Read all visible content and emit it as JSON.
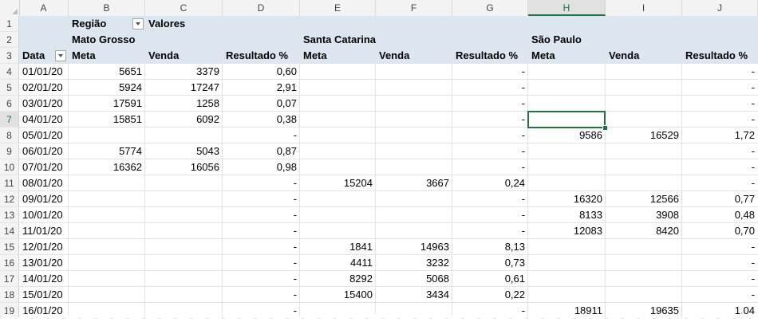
{
  "columns": [
    "A",
    "B",
    "C",
    "D",
    "E",
    "F",
    "G",
    "H",
    "I",
    "J"
  ],
  "selected_column": "H",
  "selected_row": "7",
  "pivot": {
    "row1": {
      "a": "",
      "b": "Região",
      "c": "Valores"
    },
    "regions": {
      "b": "Mato Grosso",
      "e": "Santa Catarina",
      "h": "São Paulo"
    },
    "headers": [
      "Data",
      "Meta",
      "Venda",
      "Resultado %",
      "Meta",
      "Venda",
      "Resultado %",
      "Meta",
      "Venda",
      "Resultado %"
    ]
  },
  "rows": [
    {
      "n": "4",
      "cells": [
        "01/01/20",
        "5651",
        "3379",
        "0,60",
        "",
        "",
        "-",
        "",
        "",
        "-"
      ]
    },
    {
      "n": "5",
      "cells": [
        "02/01/20",
        "5924",
        "17247",
        "2,91",
        "",
        "",
        "-",
        "",
        "",
        "-"
      ]
    },
    {
      "n": "6",
      "cells": [
        "03/01/20",
        "17591",
        "1258",
        "0,07",
        "",
        "",
        "-",
        "",
        "",
        "-"
      ]
    },
    {
      "n": "7",
      "cells": [
        "04/01/20",
        "15851",
        "6092",
        "0,38",
        "",
        "",
        "-",
        "",
        "",
        "-"
      ]
    },
    {
      "n": "8",
      "cells": [
        "05/01/20",
        "",
        "",
        "-",
        "",
        "",
        "-",
        "9586",
        "16529",
        "1,72"
      ]
    },
    {
      "n": "9",
      "cells": [
        "06/01/20",
        "5774",
        "5043",
        "0,87",
        "",
        "",
        "-",
        "",
        "",
        "-"
      ]
    },
    {
      "n": "10",
      "cells": [
        "07/01/20",
        "16362",
        "16056",
        "0,98",
        "",
        "",
        "-",
        "",
        "",
        "-"
      ]
    },
    {
      "n": "11",
      "cells": [
        "08/01/20",
        "",
        "",
        "-",
        "15204",
        "3667",
        "0,24",
        "",
        "",
        "-"
      ]
    },
    {
      "n": "12",
      "cells": [
        "09/01/20",
        "",
        "",
        "-",
        "",
        "",
        "-",
        "16320",
        "12566",
        "0,77"
      ]
    },
    {
      "n": "13",
      "cells": [
        "10/01/20",
        "",
        "",
        "-",
        "",
        "",
        "-",
        "8133",
        "3908",
        "0,48"
      ]
    },
    {
      "n": "14",
      "cells": [
        "11/01/20",
        "",
        "",
        "-",
        "",
        "",
        "-",
        "12083",
        "8420",
        "0,70"
      ]
    },
    {
      "n": "15",
      "cells": [
        "12/01/20",
        "",
        "",
        "-",
        "1841",
        "14963",
        "8,13",
        "",
        "",
        "-"
      ]
    },
    {
      "n": "16",
      "cells": [
        "13/01/20",
        "",
        "",
        "-",
        "4411",
        "3232",
        "0,73",
        "",
        "",
        "-"
      ]
    },
    {
      "n": "17",
      "cells": [
        "14/01/20",
        "",
        "",
        "-",
        "8292",
        "5068",
        "0,61",
        "",
        "",
        "-"
      ]
    },
    {
      "n": "18",
      "cells": [
        "15/01/20",
        "",
        "",
        "-",
        "15400",
        "3434",
        "0,22",
        "",
        "",
        "-"
      ]
    },
    {
      "n": "19",
      "cells": [
        "16/01/20",
        "",
        "",
        "-",
        "",
        "",
        "-",
        "18911",
        "19635",
        "1,04"
      ]
    }
  ],
  "header_row_numbers": [
    "1",
    "2",
    "3"
  ],
  "colors": {
    "band": "#dce6f1",
    "selection": "#217346"
  }
}
